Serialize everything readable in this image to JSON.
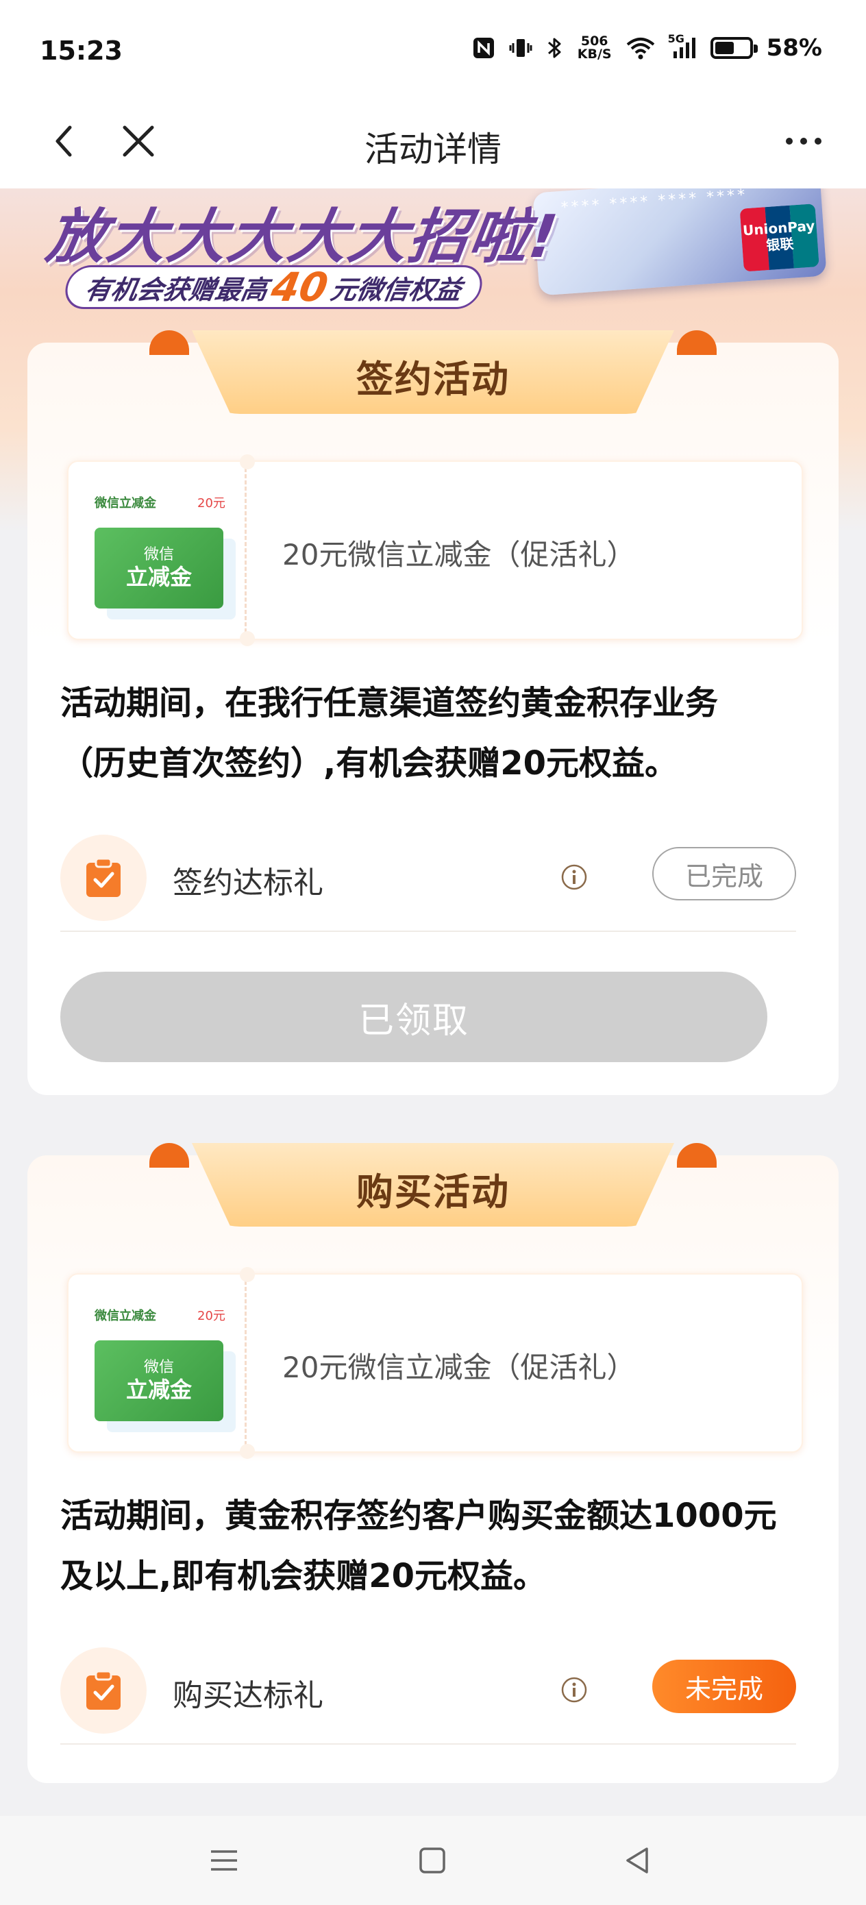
{
  "status_bar": {
    "time": "15:23",
    "speed_top": "506",
    "speed_bottom": "KB/S",
    "network": "5G",
    "battery_percent": 58,
    "battery_text": "58%",
    "icons": [
      "nfc-icon",
      "vibrate-icon",
      "bluetooth-icon",
      "network-speed",
      "wifi-icon",
      "signal-5g-icon",
      "battery-icon"
    ]
  },
  "nav": {
    "title": "活动详情",
    "icons": [
      "back-arrow-icon",
      "close-icon",
      "more-dots-icon"
    ]
  },
  "banner": {
    "headline": "放大大大大大招啦!",
    "pill_prefix": "有机会获赠最高",
    "pill_amount": "40",
    "pill_suffix": "元微信权益",
    "card_stars": "**** **** **** ****",
    "unionpay_text_1": "UnionPay",
    "unionpay_text_2": "银联"
  },
  "sections": [
    {
      "ribbon_title": "签约活动",
      "coupon": {
        "mini_label": "微信立减金",
        "mini_amount": "20元",
        "card_line_1": "微信",
        "card_line_2": "立减金",
        "title": "20元微信立减金（促活礼）"
      },
      "description_line_1": "活动期间，在我行任意渠道签约黄金积存业务",
      "description_line_2": "（历史首次签约）,有机会获赠20元权益。",
      "task": {
        "label": "签约达标礼",
        "info_icon": "info-icon",
        "status": "已完成"
      },
      "claim_button": "已领取"
    },
    {
      "ribbon_title": "购买活动",
      "coupon": {
        "mini_label": "微信立减金",
        "mini_amount": "20元",
        "card_line_1": "微信",
        "card_line_2": "立减金",
        "title": "20元微信立减金（促活礼）"
      },
      "description_line_1": "活动期间，黄金积存签约客户购买金额达1000元",
      "description_line_2": "及以上,即有机会获赠20元权益。",
      "task": {
        "label": "购买达标礼",
        "info_icon": "info-icon",
        "status": "未完成"
      }
    }
  ],
  "system_nav": [
    "menu-icon",
    "home-icon",
    "back-triangle-icon"
  ],
  "colors": {
    "accent_orange": "#f5620f",
    "ribbon": "#ffcf86",
    "banner_purple": "#6b3f9b",
    "coupon_green": "#3a9b41",
    "disabled_gray": "#cfcfcf"
  }
}
